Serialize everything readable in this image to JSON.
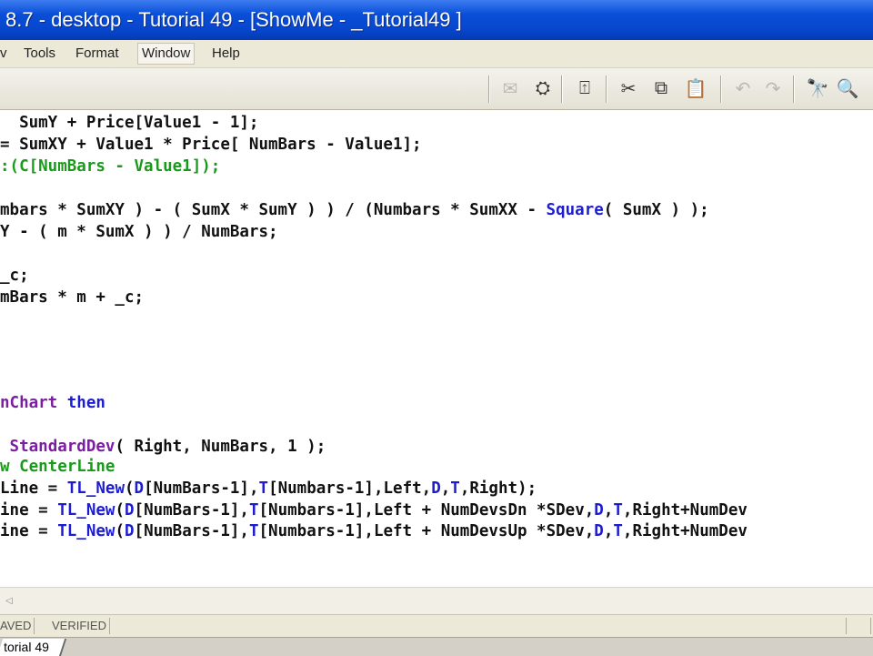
{
  "window": {
    "title": "8.7 - desktop - Tutorial 49 - [ShowMe - _Tutorial49 ]"
  },
  "menu": {
    "items": [
      "v",
      "Tools",
      "Format",
      "Window",
      "Help"
    ]
  },
  "toolbar": {
    "buttons": [
      {
        "icon": "checklist-icon",
        "glyph": "✉"
      },
      {
        "icon": "properties-icon",
        "glyph": "⛭"
      },
      {
        "icon": "insert-icon",
        "glyph": "⍐"
      },
      {
        "icon": "cut-icon",
        "glyph": "✂"
      },
      {
        "icon": "copy-icon",
        "glyph": "⧉"
      },
      {
        "icon": "paste-icon",
        "glyph": "📋"
      },
      {
        "icon": "undo-icon",
        "glyph": "↶"
      },
      {
        "icon": "redo-icon",
        "glyph": "↷"
      },
      {
        "icon": "find-icon",
        "glyph": "🔭"
      },
      {
        "icon": "find-replace-icon",
        "glyph": "🔍"
      }
    ]
  },
  "colors": {
    "keyword_blue": "#1c1cd0",
    "reserved_purple": "#7a1fa0",
    "comment_green": "#1a9a1a",
    "text_black": "#111111"
  },
  "code": {
    "lines": [
      [
        [
          "black",
          "  SumY + Price[Value1 - 1];"
        ]
      ],
      [
        [
          "black",
          "= SumXY + Value1 * Price[ NumBars - Value1];"
        ]
      ],
      [
        [
          "green",
          ":(C[NumBars - Value1]);"
        ]
      ],
      [],
      [
        [
          "black",
          "mbars * SumXY ) - ( SumX * SumY ) ) / (Numbars * SumXX - "
        ],
        [
          "blue",
          "Square"
        ],
        [
          "black",
          "( SumX ) );"
        ]
      ],
      [
        [
          "black",
          "Y - ( m * SumX ) ) / NumBars;"
        ]
      ],
      [],
      [
        [
          "black",
          "_c;"
        ]
      ],
      [
        [
          "black",
          "mBars * m + _c;"
        ]
      ],
      [],
      [],
      [],
      [
        [
          "purple",
          "nChart "
        ],
        [
          "blue",
          "then"
        ]
      ],
      [],
      [
        [
          "black",
          " "
        ],
        [
          "purple",
          "StandardDev"
        ],
        [
          "black",
          "( Right, NumBars, 1 );"
        ]
      ],
      [
        [
          "green",
          "w CenterLine"
        ]
      ],
      [
        [
          "black",
          "Line = "
        ],
        [
          "blue",
          "TL_New"
        ],
        [
          "black",
          "("
        ],
        [
          "blue",
          "D"
        ],
        [
          "black",
          "[NumBars-1],"
        ],
        [
          "blue",
          "T"
        ],
        [
          "black",
          "[Numbars-1],Left,"
        ],
        [
          "blue",
          "D"
        ],
        [
          "black",
          ","
        ],
        [
          "blue",
          "T"
        ],
        [
          "black",
          ",Right);"
        ]
      ],
      [
        [
          "black",
          "ine = "
        ],
        [
          "blue",
          "TL_New"
        ],
        [
          "black",
          "("
        ],
        [
          "blue",
          "D"
        ],
        [
          "black",
          "[NumBars-1],"
        ],
        [
          "blue",
          "T"
        ],
        [
          "black",
          "[Numbars-1],Left + NumDevsDn *SDev,"
        ],
        [
          "blue",
          "D"
        ],
        [
          "black",
          ","
        ],
        [
          "blue",
          "T"
        ],
        [
          "black",
          ",Right+NumDev"
        ]
      ],
      [
        [
          "black",
          "ine = "
        ],
        [
          "blue",
          "TL_New"
        ],
        [
          "black",
          "("
        ],
        [
          "blue",
          "D"
        ],
        [
          "black",
          "[NumBars-1],"
        ],
        [
          "blue",
          "T"
        ],
        [
          "black",
          "[Numbars-1],Left + NumDevsUp *SDev,"
        ],
        [
          "blue",
          "D"
        ],
        [
          "black",
          ","
        ],
        [
          "blue",
          "T"
        ],
        [
          "black",
          ",Right+NumDev"
        ]
      ]
    ]
  },
  "status": {
    "saved": "AVED",
    "verified": "VERIFIED"
  },
  "tabs": {
    "active": "torial 49"
  }
}
